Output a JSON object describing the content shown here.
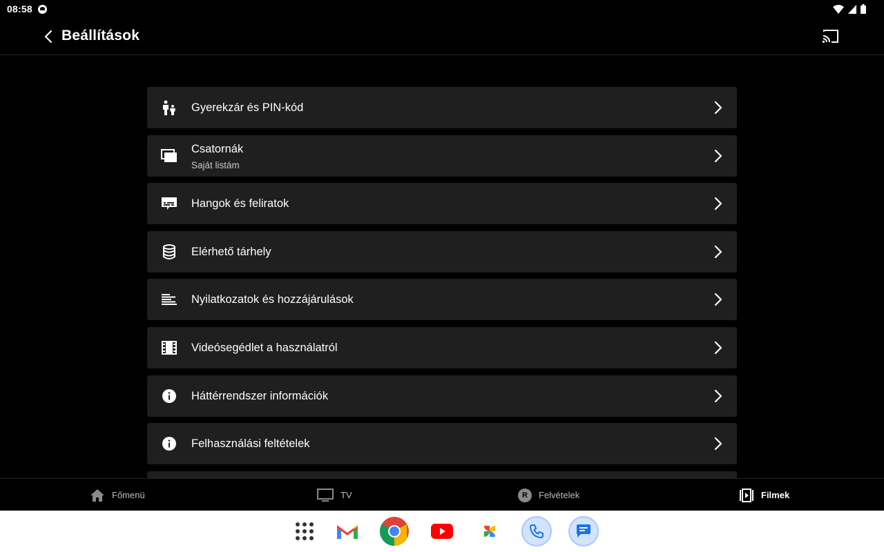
{
  "status_bar": {
    "time": "08:58"
  },
  "header": {
    "title": "Beállítások"
  },
  "settings": [
    {
      "label": "Gyerekzár és PIN-kód",
      "icon": "parental-lock-icon"
    },
    {
      "label": "Csatornák",
      "sublabel": "Saját listám",
      "icon": "channels-icon"
    },
    {
      "label": "Hangok és feliratok",
      "icon": "subtitles-icon"
    },
    {
      "label": "Elérhető tárhely",
      "icon": "storage-icon"
    },
    {
      "label": "Nyilatkozatok és hozzájárulások",
      "icon": "list-icon"
    },
    {
      "label": "Videósegédlet a használatról",
      "icon": "film-icon"
    },
    {
      "label": "Háttérrendszer információk",
      "icon": "info-icon"
    },
    {
      "label": "Felhasználási feltételek",
      "icon": "info-icon"
    }
  ],
  "bottom_nav": [
    {
      "label": "Főmenü",
      "icon": "home-icon",
      "active": false
    },
    {
      "label": "TV",
      "icon": "tv-icon",
      "active": false
    },
    {
      "label": "Felvételek",
      "icon": "recordings-icon",
      "badge": "R",
      "active": false
    },
    {
      "label": "Filmek",
      "icon": "movies-icon",
      "active": true
    }
  ],
  "taskbar": {
    "apps": [
      "app-drawer",
      "gmail",
      "chrome",
      "youtube",
      "photos",
      "phone",
      "messages"
    ]
  },
  "colors": {
    "background": "#000000",
    "row": "#1f1f1f",
    "text": "#ffffff",
    "secondary_text": "#c8c8c8"
  }
}
